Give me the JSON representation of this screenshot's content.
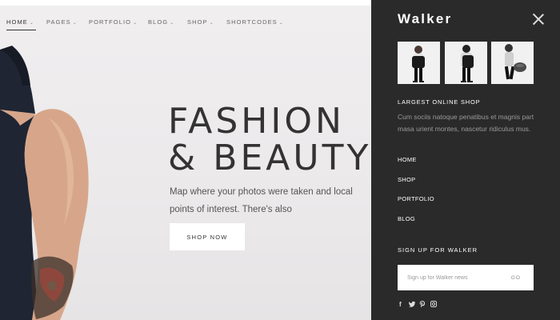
{
  "nav": {
    "items": [
      {
        "label": "HOME",
        "active": true
      },
      {
        "label": "PAGES"
      },
      {
        "label": "PORTFOLIO"
      },
      {
        "label": "BLOG"
      },
      {
        "label": "SHOP"
      },
      {
        "label": "SHORTCODES"
      }
    ]
  },
  "hero": {
    "headline_line1": "FASHION",
    "headline_line2": "& BEAUTY",
    "subtext": "Map where your photos were taken and local points of interest. There's also",
    "cta": "SHOP NOW"
  },
  "panel": {
    "brand": "Walker",
    "close_icon": "close-icon",
    "section_title": "LARGEST ONLINE SHOP",
    "section_desc": "Cum sociis natoque penatibus et magnis part masa urient montes, nascetur ridiculus mus.",
    "menu": [
      "HOME",
      "SHOP",
      "PORTFOLIO",
      "BLOG"
    ],
    "signup_title": "SIGN UP FOR WALKER",
    "signup_placeholder": "Sign up for Walker news",
    "signup_button": "GO",
    "social_icons": [
      "facebook-icon",
      "twitter-icon",
      "pinterest-icon",
      "instagram-icon"
    ]
  },
  "colors": {
    "panel_bg": "#2a2a2a",
    "hero_bg": "#eeeced",
    "text_dark": "#333333"
  }
}
